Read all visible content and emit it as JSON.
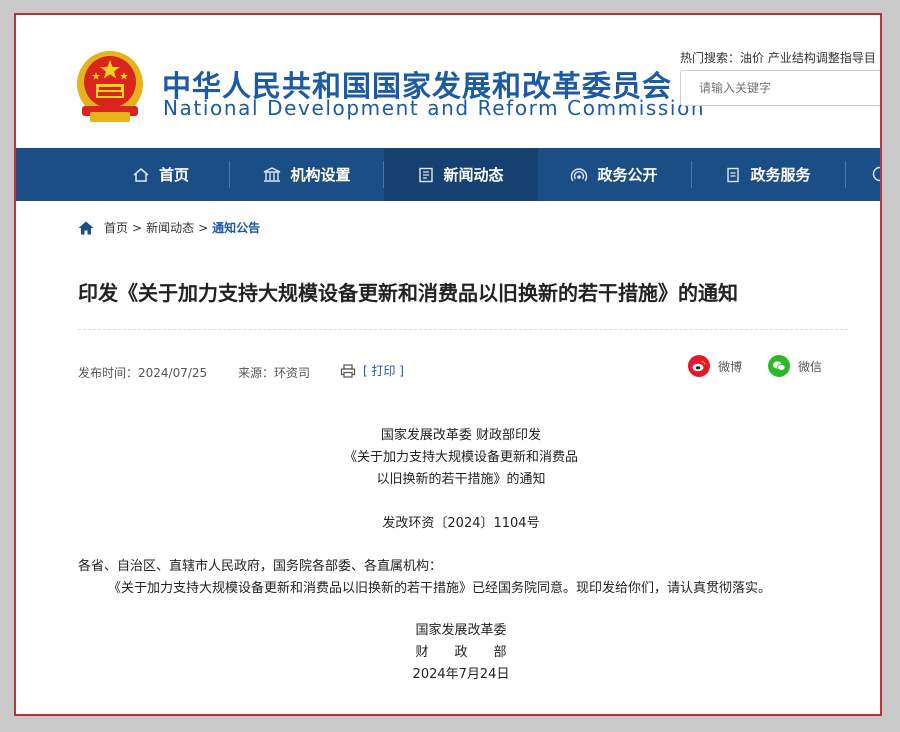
{
  "header": {
    "title_cn": "中华人民共和国国家发展和改革委员会",
    "title_en": "National Development and Reform Commission",
    "hot_search": "热门搜索：油价   产业结构调整指导目",
    "search_placeholder": "请输入关键字",
    "colors": {
      "brand": "#1c5aa3",
      "nav": "#1c4e86",
      "frame": "#b8323a"
    }
  },
  "nav": {
    "items": [
      {
        "label": "首页",
        "icon": "home-icon"
      },
      {
        "label": "机构设置",
        "icon": "institution-icon"
      },
      {
        "label": "新闻动态",
        "icon": "news-icon"
      },
      {
        "label": "政务公开",
        "icon": "broadcast-icon"
      },
      {
        "label": "政务服务",
        "icon": "document-icon"
      }
    ]
  },
  "breadcrumb": {
    "home": "首页",
    "sep": ">",
    "section": "新闻动态",
    "current": "通知公告"
  },
  "article": {
    "title": "印发《关于加力支持大规模设备更新和消费品以旧换新的若干措施》的通知",
    "publish": "发布时间：2024/07/25",
    "source": "来源：环资司",
    "print": "[ 打印 ]",
    "share_weibo": "微博",
    "share_wechat": "微信",
    "issuer": "国家发展改革委 财政部印发",
    "subtitle_line1": "《关于加力支持大规模设备更新和消费品",
    "subtitle_line2": "以旧换新的若干措施》的通知",
    "doc_no": "发改环资〔2024〕1104号",
    "recipients": "各省、自治区、直辖市人民政府，国务院各部委、各直属机构：",
    "paragraph": "《关于加力支持大规模设备更新和消费品以旧换新的若干措施》已经国务院同意。现印发给你们，请认真贯彻落实。",
    "sign1": "国家发展改革委",
    "sign2": "财　　政　　部",
    "date": "2024年7月24日"
  }
}
